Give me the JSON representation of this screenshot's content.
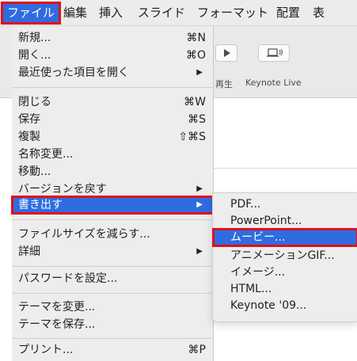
{
  "menubar": {
    "items": [
      {
        "label": "ファイル",
        "active": true
      },
      {
        "label": "編集"
      },
      {
        "label": "挿入"
      },
      {
        "label": "スライド"
      },
      {
        "label": "フォーマット"
      },
      {
        "label": "配置"
      },
      {
        "label": "表"
      }
    ]
  },
  "toolbar": {
    "play_label": "再生",
    "keynote_live_label": "Keynote Live"
  },
  "file_menu": {
    "items": [
      {
        "label": "新規...",
        "shortcut": "⌘N"
      },
      {
        "label": "開く...",
        "shortcut": "⌘O"
      },
      {
        "label": "最近使った項目を開く",
        "submenu_arrow": "▶"
      },
      {
        "label": "閉じる",
        "shortcut": "⌘W"
      },
      {
        "label": "保存",
        "shortcut": "⌘S"
      },
      {
        "label": "複製",
        "shortcut": "⇧⌘S"
      },
      {
        "label": "名称変更..."
      },
      {
        "label": "移動..."
      },
      {
        "label": "バージョンを戻す",
        "submenu_arrow": "▶"
      },
      {
        "label": "書き出す",
        "submenu_arrow": "▶",
        "highlighted": true
      },
      {
        "label": "ファイルサイズを減らす..."
      },
      {
        "label": "詳細",
        "submenu_arrow": "▶"
      },
      {
        "label": "パスワードを設定..."
      },
      {
        "label": "テーマを変更..."
      },
      {
        "label": "テーマを保存..."
      },
      {
        "label": "プリント...",
        "shortcut": "⌘P"
      }
    ]
  },
  "export_submenu": {
    "items": [
      {
        "label": "PDF..."
      },
      {
        "label": "PowerPoint..."
      },
      {
        "label": "ムービー...",
        "highlighted": true
      },
      {
        "label": "アニメーションGIF..."
      },
      {
        "label": "イメージ..."
      },
      {
        "label": "HTML..."
      },
      {
        "label": "Keynote '09..."
      }
    ]
  },
  "colors": {
    "highlight": "#2f6ce0",
    "callout_border": "#e0101a",
    "menu_bg": "#ededed"
  }
}
